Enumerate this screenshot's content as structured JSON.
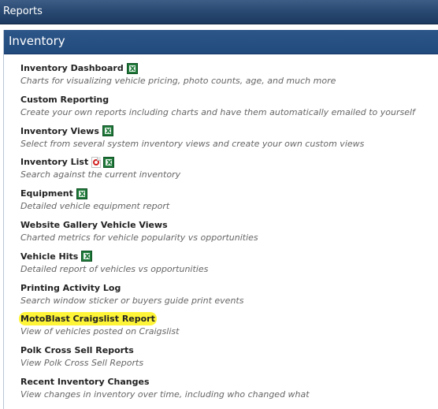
{
  "topbar": {
    "title": "Reports"
  },
  "panel": {
    "title": "Inventory"
  },
  "items": [
    {
      "title": "Inventory Dashboard",
      "desc": "Charts for visualizing vehicle pricing, photo counts, age, and much more",
      "icons": [
        "excel-icon"
      ]
    },
    {
      "title": "Custom Reporting",
      "desc": "Create your own reports including charts and have them automatically emailed to yourself",
      "icons": []
    },
    {
      "title": "Inventory Views",
      "desc": "Select from several system inventory views and create your own custom views",
      "icons": [
        "excel-icon"
      ]
    },
    {
      "title": "Inventory List",
      "desc": "Search against the current inventory",
      "icons": [
        "pdf-icon",
        "excel-icon"
      ]
    },
    {
      "title": "Equipment",
      "desc": "Detailed vehicle equipment report",
      "icons": [
        "excel-icon"
      ]
    },
    {
      "title": "Website Gallery Vehicle Views",
      "desc": "Charted metrics for vehicle popularity vs opportunities",
      "icons": []
    },
    {
      "title": "Vehicle Hits",
      "desc": "Detailed report of vehicles vs opportunities",
      "icons": [
        "excel-icon"
      ]
    },
    {
      "title": "Printing Activity Log",
      "desc": "Search window sticker or buyers guide print events",
      "icons": []
    },
    {
      "title": "MotoBlast Craigslist Report",
      "desc": "View of vehicles posted on Craigslist",
      "icons": [],
      "highlighted": true,
      "highlight_color": "#fff538"
    },
    {
      "title": "Polk Cross Sell Reports",
      "desc": "View Polk Cross Sell Reports",
      "icons": []
    },
    {
      "title": "Recent Inventory Changes",
      "desc": "View changes in inventory over time, including who changed what",
      "icons": []
    }
  ],
  "colors": {
    "header_blue": "#214a7d",
    "topbar_blue": "#2a4a73",
    "title_text": "#222222",
    "desc_text": "#666666",
    "excel_green": "#1f7a3a",
    "pdf_red": "#d32020"
  }
}
